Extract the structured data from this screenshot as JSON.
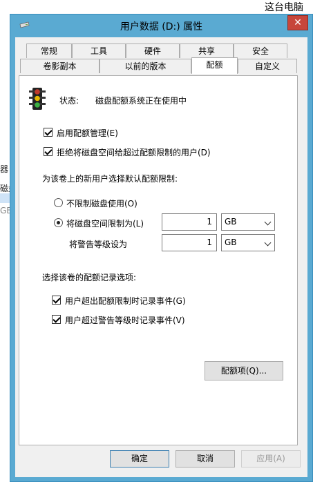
{
  "background": {
    "window_title": "这台电脑",
    "left_fragments": [
      "器",
      "磁盘",
      "GB"
    ]
  },
  "dialog": {
    "title": "用户数据 (D:) 属性",
    "close_symbol": "✕"
  },
  "tabs_top": [
    "常规",
    "工具",
    "硬件",
    "共享",
    "安全"
  ],
  "tabs_bottom": [
    "卷影副本",
    "以前的版本",
    "配额",
    "自定义"
  ],
  "active_tab": "配额",
  "quota": {
    "status_label": "状态:",
    "status_value": "磁盘配额系统正在使用中",
    "enable_quota": "启用配额管理(E)",
    "deny_space": "拒绝将磁盘空间给超过配额限制的用户(D)",
    "default_limit_heading": "为该卷上的新用户选择默认配额限制:",
    "no_limit": "不限制磁盘使用(O)",
    "limit_to": "将磁盘空间限制为(L)",
    "limit_value": "1",
    "limit_unit": "GB",
    "warning_label": "将警告等级设为",
    "warning_value": "1",
    "warning_unit": "GB",
    "logging_heading": "选择该卷的配额记录选项:",
    "log_exceed_limit": "用户超出配额限制时记录事件(G)",
    "log_exceed_warning": "用户超过警告等级时记录事件(V)",
    "entries_button": "配额项(Q)..."
  },
  "buttons": {
    "ok": "确定",
    "cancel": "取消",
    "apply": "应用(A)"
  },
  "colors": {
    "titlebar": "#5aaad2",
    "close": "#c7463b"
  }
}
